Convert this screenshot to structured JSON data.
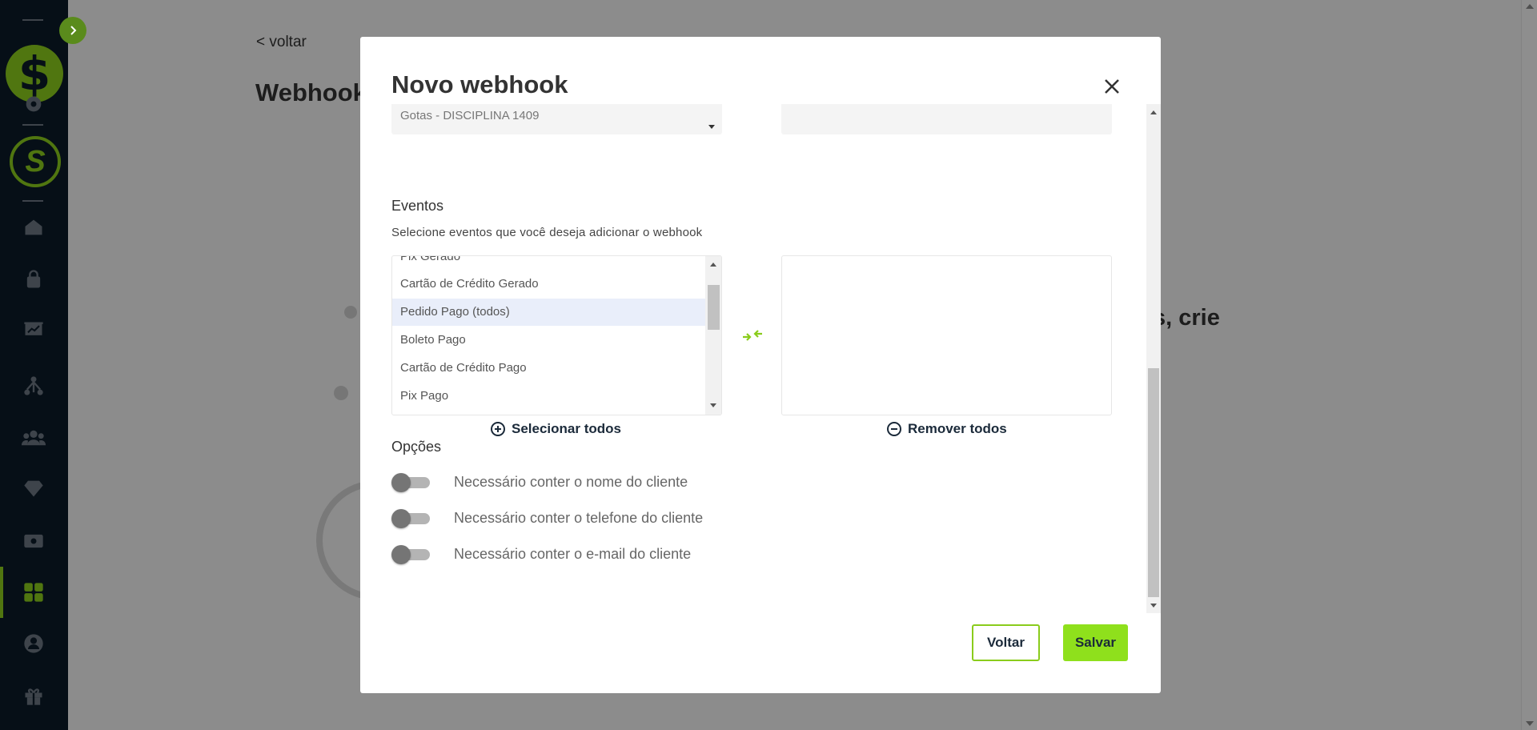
{
  "background": {
    "back_link": "< voltar",
    "title": "Webhook",
    "text_fragment": "s, crie"
  },
  "modal": {
    "title": "Novo webhook",
    "product_select": {
      "value": "Gotas - DISCIPLINA 1409"
    },
    "events": {
      "title": "Eventos",
      "subtitle": "Selecione eventos que você deseja adicionar o webhook",
      "available": [
        "Pix Gerado",
        "Cartão de Crédito Gerado",
        "Pedido Pago (todos)",
        "Boleto Pago",
        "Cartão de Crédito Pago",
        "Pix Pago"
      ],
      "selected_index": 2,
      "select_all_label": "Selecionar todos",
      "remove_all_label": "Remover todos"
    },
    "options": {
      "title": "Opções",
      "toggles": [
        {
          "label": "Necessário conter o nome do cliente",
          "on": false
        },
        {
          "label": "Necessário conter o telefone do cliente",
          "on": false
        },
        {
          "label": "Necessário conter o e-mail do cliente",
          "on": false
        }
      ]
    },
    "buttons": {
      "back": "Voltar",
      "save": "Salvar"
    }
  },
  "colors": {
    "accent": "#8acc1c",
    "sidebar": "#0b1a28",
    "save_button": "#8fe01c"
  },
  "icons": {
    "sidebar": [
      "settings-icon",
      "home-icon",
      "bag-icon",
      "presentation-icon",
      "network-icon",
      "users-icon",
      "diamond-icon",
      "cash-icon",
      "apps-icon",
      "user-circle-icon",
      "gift-icon"
    ]
  }
}
